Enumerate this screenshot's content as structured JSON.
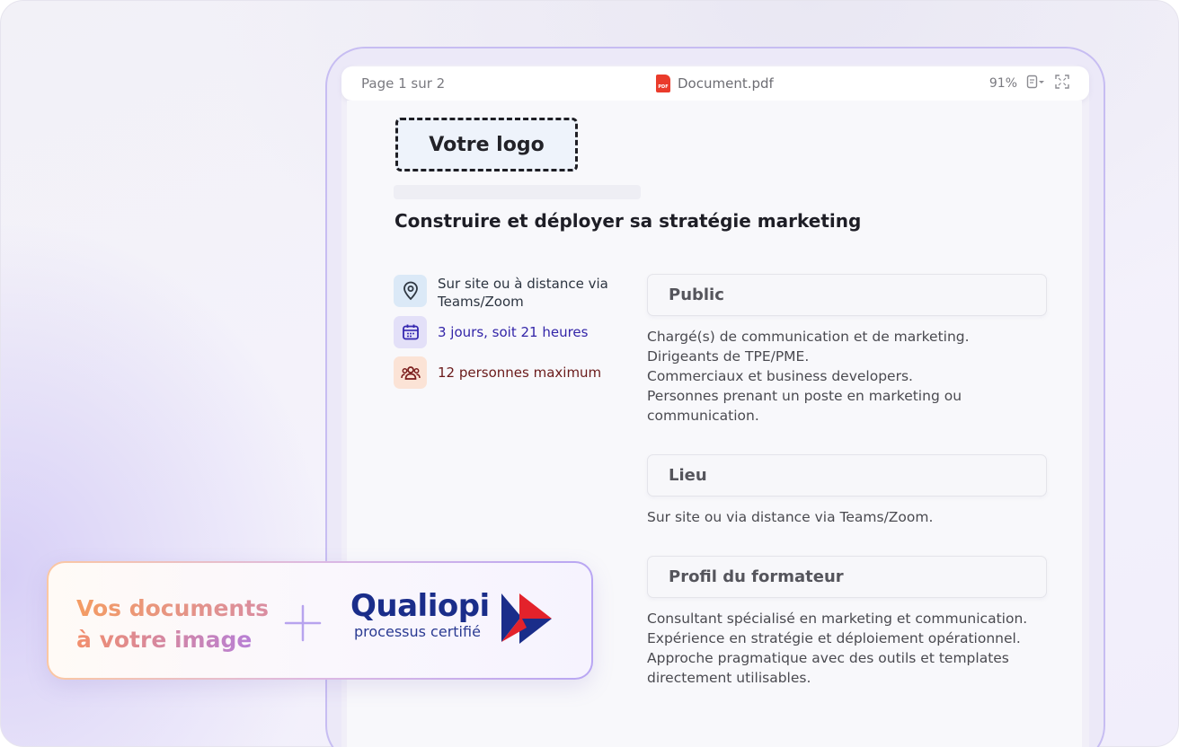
{
  "viewer": {
    "page_indicator": "Page 1 sur 2",
    "file_name": "Document.pdf",
    "zoom": "91%",
    "icons": [
      "pdf-icon",
      "page-view-icon",
      "fullscreen-icon"
    ]
  },
  "document": {
    "logo_placeholder": "Votre logo",
    "title": "Construire et déployer sa stratégie marketing",
    "info": {
      "location": "Sur site ou à distance via Teams/Zoom",
      "duration": "3 jours, soit 21 heures",
      "capacity": "12 personnes maximum"
    },
    "sections": [
      {
        "heading": "Public",
        "body": "Chargé(s) de communication et de marketing.\nDirigeants de TPE/PME.\nCommerciaux et business developers.\nPersonnes prenant un poste en marketing ou communication."
      },
      {
        "heading": "Lieu",
        "body": "Sur site ou via distance via Teams/Zoom."
      },
      {
        "heading": "Profil du formateur",
        "body": "Consultant spécialisé en marketing et communication.\nExpérience en stratégie et déploiement opérationnel.\nApproche pragmatique avec des outils et templates directement utilisables."
      }
    ]
  },
  "promo": {
    "line1": "Vos documents",
    "line2": "à votre image",
    "brand": "Qualiopi",
    "brand_sub": "processus certifié"
  },
  "colors": {
    "device_border": "#c7bdf2",
    "qualiopi_blue": "#1a2d8a",
    "qualiopi_red": "#e3222b",
    "promo_orange": "#f49c63",
    "promo_purple": "#b27ee0"
  }
}
